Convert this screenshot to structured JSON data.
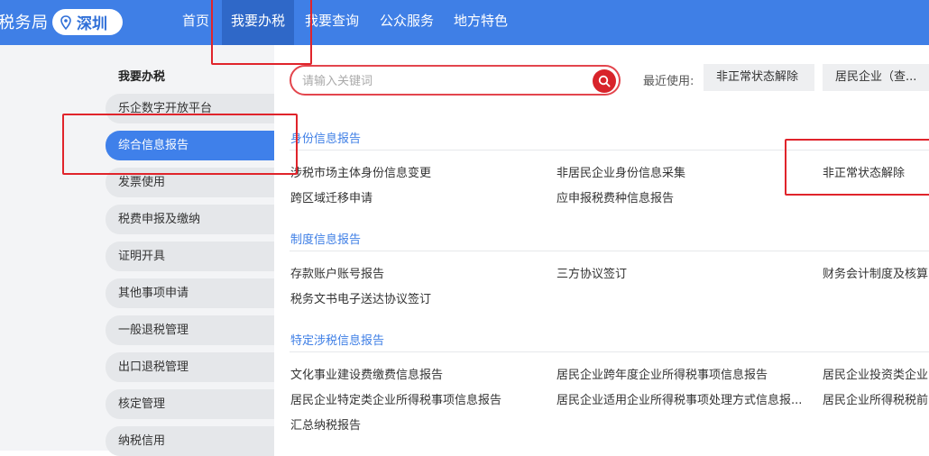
{
  "header": {
    "brand": "税务局",
    "city": "深圳",
    "nav": [
      "首页",
      "我要办税",
      "我要查询",
      "公众服务",
      "地方特色"
    ]
  },
  "sidebar": {
    "title": "我要办税",
    "items": [
      "乐企数字开放平台",
      "综合信息报告",
      "发票使用",
      "税费申报及缴纳",
      "证明开具",
      "其他事项申请",
      "一般退税管理",
      "出口退税管理",
      "核定管理",
      "纳税信用"
    ]
  },
  "search": {
    "placeholder": "请输入关键词",
    "recent_label": "最近使用:",
    "recent": [
      "非正常状态解除",
      "居民企业（查..."
    ]
  },
  "sections": [
    {
      "title": "身份信息报告",
      "links": [
        "涉税市场主体身份信息变更",
        "非居民企业身份信息采集",
        "非正常状态解除",
        "跨区域迁移申请",
        "应申报税费种信息报告"
      ]
    },
    {
      "title": "制度信息报告",
      "links": [
        "存款账户账号报告",
        "三方协议签订",
        "财务会计制度及核算",
        "税务文书电子送达协议签订"
      ]
    },
    {
      "title": "特定涉税信息报告",
      "links": [
        "文化事业建设费缴费信息报告",
        "居民企业跨年度企业所得税事项信息报告",
        "居民企业投资类企业",
        "居民企业特定类企业所得税事项信息报告",
        "居民企业适用企业所得税事项处理方式信息报...",
        "居民企业所得税税前",
        "汇总纳税报告"
      ]
    }
  ]
}
